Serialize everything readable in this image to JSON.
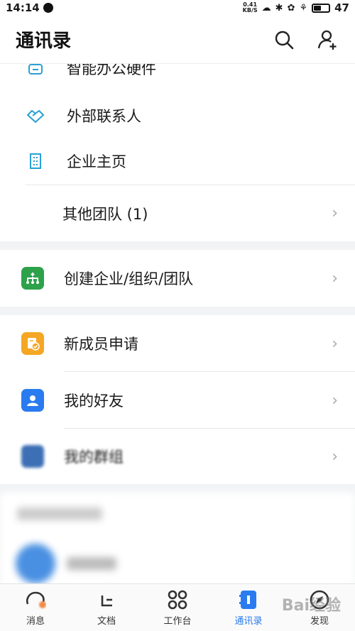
{
  "status_bar": {
    "time": "14:14",
    "net_speed_value": "0.41",
    "net_speed_unit": "KB/S",
    "battery_level": "47"
  },
  "header": {
    "title": "通讯录",
    "search_icon": "search-icon",
    "add_contact_icon": "add-contact-icon"
  },
  "sections": {
    "enterprise": {
      "items": [
        {
          "label": "智能办公硬件",
          "icon": "office-hardware-icon"
        },
        {
          "label": "外部联系人",
          "icon": "handshake-icon"
        },
        {
          "label": "企业主页",
          "icon": "building-icon"
        },
        {
          "label": "其他团队 (1)"
        }
      ]
    },
    "create": {
      "label": "创建企业/组织/团队",
      "icon": "org-tree-icon",
      "icon_color": "#2ea14b"
    },
    "personal": {
      "items": [
        {
          "label": "新成员申请",
          "icon": "member-request-icon",
          "icon_color": "#f5a623"
        },
        {
          "label": "我的好友",
          "icon": "friend-icon",
          "icon_color": "#2a7bf0"
        },
        {
          "label": "我的群组",
          "icon": "group-icon",
          "icon_color": "#3d6fb5"
        }
      ]
    }
  },
  "tabbar": {
    "tabs": [
      {
        "label": "消息",
        "icon": "message-icon"
      },
      {
        "label": "文档",
        "icon": "document-icon"
      },
      {
        "label": "工作台",
        "icon": "workbench-icon"
      },
      {
        "label": "通讯录",
        "icon": "contacts-icon",
        "active": true
      },
      {
        "label": "发现",
        "icon": "discover-icon"
      }
    ]
  },
  "colors": {
    "accent": "#2a7bf0",
    "icon_blue": "#2a9fd6"
  },
  "watermark": "Bai经验"
}
